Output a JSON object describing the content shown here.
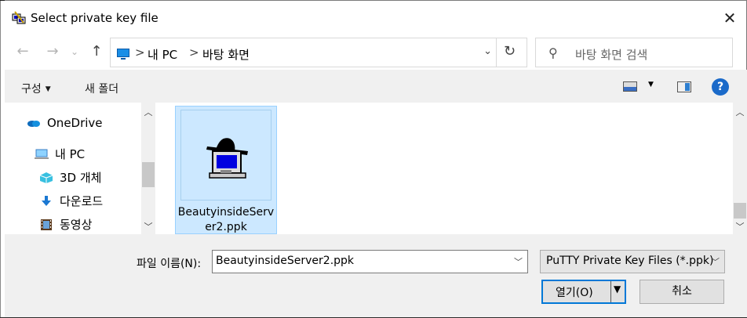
{
  "window": {
    "title": "Select private key file",
    "close_label": "✕"
  },
  "nav": {
    "back_icon": "←",
    "forward_icon": "→",
    "history_icon": "⌄",
    "up_icon": "↑"
  },
  "address": {
    "breadcrumbs": [
      "내 PC",
      "바탕 화면"
    ],
    "separator": ">",
    "dropdown_icon": "⌄",
    "refresh_icon": "↻"
  },
  "search": {
    "placeholder": "바탕 화면 검색",
    "icon": "⚲"
  },
  "toolbar": {
    "organize_label": "구성",
    "new_folder_label": "새 폴더",
    "help_label": "?"
  },
  "sidebar": {
    "items": [
      {
        "label": "OneDrive",
        "icon": "onedrive-icon"
      },
      {
        "label": "내 PC",
        "icon": "pc-icon"
      },
      {
        "label": "3D 개체",
        "icon": "3d-objects-icon"
      },
      {
        "label": "다운로드",
        "icon": "downloads-icon"
      },
      {
        "label": "동영상",
        "icon": "videos-icon"
      }
    ]
  },
  "files": [
    {
      "name_line1": "BeautyinsideServ",
      "name_line2": "er2.ppk",
      "selected": true
    }
  ],
  "bottom": {
    "filename_label": "파일 이름(N):",
    "filename_value": "BeautyinsideServer2.ppk",
    "filter_value": "PuTTY Private Key Files (*.ppk)",
    "open_label": "열기(O)",
    "cancel_label": "취소"
  },
  "colors": {
    "selection": "#cce8ff",
    "accent": "#0078d7"
  }
}
